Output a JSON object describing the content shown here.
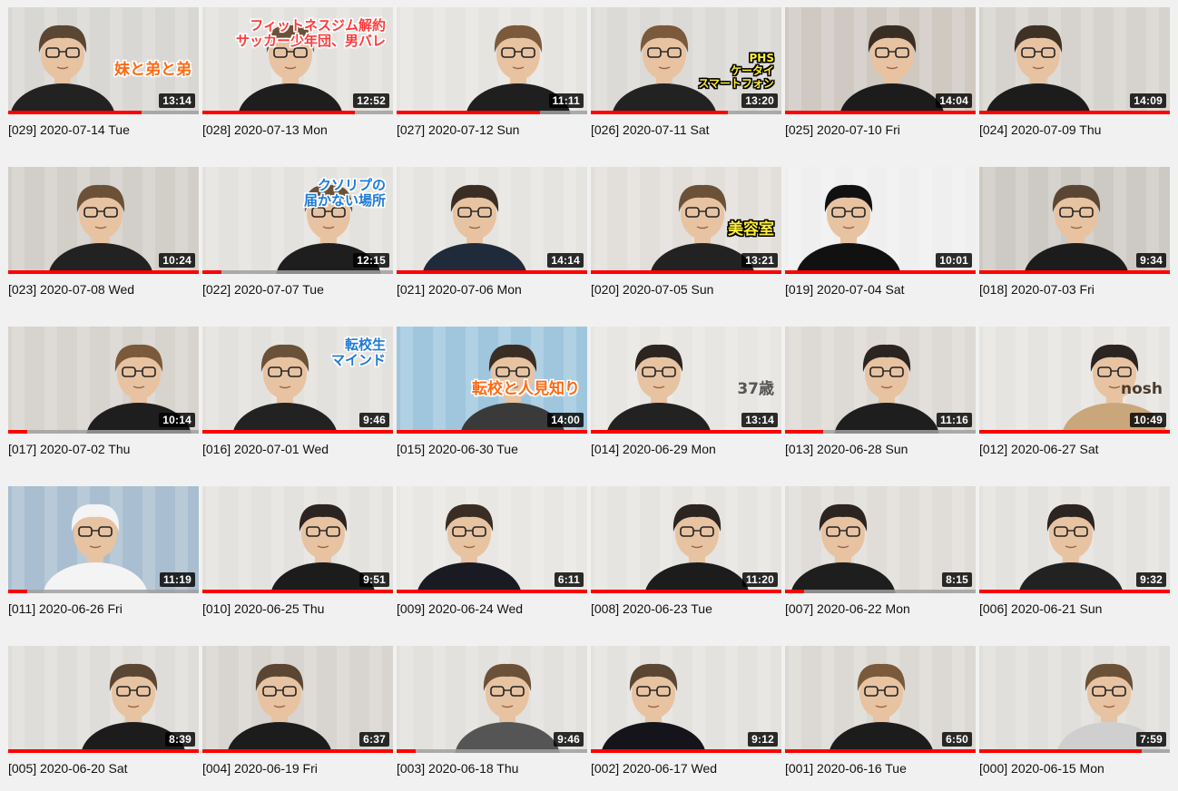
{
  "watched_color": "#ff0000",
  "videos": [
    {
      "title": "[029] 2020-07-14 Tue",
      "duration": "13:14",
      "progress": 0.7,
      "bg": "#d9d7d4",
      "shirt": "#222222",
      "hair": "#5a4632",
      "overlay": "妹と弟と弟",
      "overlay_color": "#ff6a13",
      "overlay_stroke": "#ffffff"
    },
    {
      "title": "[028] 2020-07-13 Mon",
      "duration": "12:52",
      "progress": 0.8,
      "bg": "#e3e1dd",
      "shirt": "#1e1e1e",
      "hair": "#6b5138",
      "overlay": "フィットネスジム解約\nサッカー少年団、男バレ",
      "overlay_color": "#ff3b3b",
      "overlay_stroke": "#ffffff"
    },
    {
      "title": "[027] 2020-07-12 Sun",
      "duration": "11:11",
      "progress": 0.75,
      "bg": "#e6e4e0",
      "shirt": "#1f1f1f",
      "hair": "#7a5a3a",
      "overlay": "",
      "overlay_color": "#ffffff",
      "overlay_stroke": "#000000"
    },
    {
      "title": "[026] 2020-07-11 Sat",
      "duration": "13:20",
      "progress": 0.72,
      "bg": "#dcdad6",
      "shirt": "#222222",
      "hair": "#7a5a3a",
      "overlay": "PHS\nケータイ\nスマートフォン",
      "overlay_color": "#ffee33",
      "overlay_stroke": "#000000"
    },
    {
      "title": "[025] 2020-07-10 Fri",
      "duration": "14:04",
      "progress": 1.0,
      "bg": "#cfc9c2",
      "shirt": "#1c1c1c",
      "hair": "#3a2e24",
      "overlay": "",
      "overlay_color": "#ffffff",
      "overlay_stroke": "#000000"
    },
    {
      "title": "[024] 2020-07-09 Thu",
      "duration": "14:09",
      "progress": 1.0,
      "bg": "#d6d3ce",
      "shirt": "#1c1c1c",
      "hair": "#3f3124",
      "overlay": "",
      "overlay_color": "#ffffff",
      "overlay_stroke": "#000000"
    },
    {
      "title": "[023] 2020-07-08 Wed",
      "duration": "10:24",
      "progress": 1.0,
      "bg": "#d2cfc9",
      "shirt": "#222222",
      "hair": "#6b5138",
      "overlay": "",
      "overlay_color": "#ffffff",
      "overlay_stroke": "#000000"
    },
    {
      "title": "[022] 2020-07-07 Tue",
      "duration": "12:15",
      "progress": 0.1,
      "bg": "#e4e2de",
      "shirt": "#1e1e1e",
      "hair": "#6b5138",
      "overlay": "クソリプの\n届かない場所",
      "overlay_color": "#1f7ad6",
      "overlay_stroke": "#ffffff"
    },
    {
      "title": "[021] 2020-07-06 Mon",
      "duration": "14:14",
      "progress": 1.0,
      "bg": "#e6e4e0",
      "shirt": "#1f2a3a",
      "hair": "#3a2e24",
      "overlay": "",
      "overlay_color": "#ffffff",
      "overlay_stroke": "#000000"
    },
    {
      "title": "[020] 2020-07-05 Sun",
      "duration": "13:21",
      "progress": 1.0,
      "bg": "#e2dfdb",
      "shirt": "#222222",
      "hair": "#6b5138",
      "overlay": "美容室",
      "overlay_color": "#ffee33",
      "overlay_stroke": "#000000"
    },
    {
      "title": "[019] 2020-07-04 Sat",
      "duration": "10:01",
      "progress": 1.0,
      "bg": "#efefef",
      "shirt": "#111111",
      "hair": "#111111",
      "overlay": "",
      "overlay_color": "#ffffff",
      "overlay_stroke": "#000000"
    },
    {
      "title": "[018] 2020-07-03 Fri",
      "duration": "9:34",
      "progress": 1.0,
      "bg": "#cdc9c3",
      "shirt": "#1c1c1c",
      "hair": "#5a4632",
      "overlay": "",
      "overlay_color": "#ffffff",
      "overlay_stroke": "#000000"
    },
    {
      "title": "[017] 2020-07-02 Thu",
      "duration": "10:14",
      "progress": 0.1,
      "bg": "#d7d3cd",
      "shirt": "#1e1e1e",
      "hair": "#7a5a3a",
      "overlay": "",
      "overlay_color": "#ffffff",
      "overlay_stroke": "#000000"
    },
    {
      "title": "[016] 2020-07-01 Wed",
      "duration": "9:46",
      "progress": 1.0,
      "bg": "#e3e1dd",
      "shirt": "#222222",
      "hair": "#6b5138",
      "overlay": "転校生\nマインド",
      "overlay_color": "#1f7ad6",
      "overlay_stroke": "#ffffff"
    },
    {
      "title": "[015] 2020-06-30 Tue",
      "duration": "14:00",
      "progress": 1.0,
      "bg": "#9fc6dd",
      "shirt": "#3a3a3a",
      "hair": "#3a2e24",
      "overlay": "転校と人見知り",
      "overlay_color": "#ff6a13",
      "overlay_stroke": "#ffffff"
    },
    {
      "title": "[014] 2020-06-29 Mon",
      "duration": "13:14",
      "progress": 1.0,
      "bg": "#e8e6e2",
      "shirt": "#222222",
      "hair": "#2b2420",
      "overlay": "37歳",
      "overlay_color": "#555555",
      "overlay_stroke": "none"
    },
    {
      "title": "[013] 2020-06-28 Sun",
      "duration": "11:16",
      "progress": 0.2,
      "bg": "#dddad5",
      "shirt": "#1e1e1e",
      "hair": "#2b2420",
      "overlay": "",
      "overlay_color": "#ffffff",
      "overlay_stroke": "#000000"
    },
    {
      "title": "[012] 2020-06-27 Sat",
      "duration": "10:49",
      "progress": 1.0,
      "bg": "#e6e4e0",
      "shirt": "#c9a77a",
      "hair": "#2b2420",
      "overlay": "nosh",
      "overlay_color": "#4b3a2a",
      "overlay_stroke": "none"
    },
    {
      "title": "[011] 2020-06-26 Fri",
      "duration": "11:19",
      "progress": 0.1,
      "bg": "#a9bed0",
      "shirt": "#f4f4f4",
      "hair": "#f4f4f4",
      "overlay": "",
      "overlay_color": "#ffffff",
      "overlay_stroke": "#000000"
    },
    {
      "title": "[010] 2020-06-25 Thu",
      "duration": "9:51",
      "progress": 1.0,
      "bg": "#e4e2de",
      "shirt": "#1c1c1c",
      "hair": "#2b2420",
      "overlay": "",
      "overlay_color": "#ffffff",
      "overlay_stroke": "#000000"
    },
    {
      "title": "[009] 2020-06-24 Wed",
      "duration": "6:11",
      "progress": 1.0,
      "bg": "#e9e7e3",
      "shirt": "#1a1a22",
      "hair": "#3a2e24",
      "overlay": "",
      "overlay_color": "#ffffff",
      "overlay_stroke": "#000000"
    },
    {
      "title": "[008] 2020-06-23 Tue",
      "duration": "11:20",
      "progress": 1.0,
      "bg": "#e6e4e0",
      "shirt": "#1c1c1c",
      "hair": "#2b2420",
      "overlay": "",
      "overlay_color": "#ffffff",
      "overlay_stroke": "#000000"
    },
    {
      "title": "[007] 2020-06-22 Mon",
      "duration": "8:15",
      "progress": 0.1,
      "bg": "#e0ddd8",
      "shirt": "#1e1e1e",
      "hair": "#2b2420",
      "overlay": "",
      "overlay_color": "#ffffff",
      "overlay_stroke": "#000000"
    },
    {
      "title": "[006] 2020-06-21 Sun",
      "duration": "9:32",
      "progress": 1.0,
      "bg": "#e4e2de",
      "shirt": "#222222",
      "hair": "#2b2420",
      "overlay": "",
      "overlay_color": "#ffffff",
      "overlay_stroke": "#000000"
    },
    {
      "title": "[005] 2020-06-20 Sat",
      "duration": "8:39",
      "progress": 1.0,
      "bg": "#dfddd9",
      "shirt": "#1c1c1c",
      "hair": "#5a4632",
      "overlay": "",
      "overlay_color": "#ffffff",
      "overlay_stroke": "#000000"
    },
    {
      "title": "[004] 2020-06-19 Fri",
      "duration": "6:37",
      "progress": 1.0,
      "bg": "#d8d5d0",
      "shirt": "#1c1c1c",
      "hair": "#5a4632",
      "overlay": "",
      "overlay_color": "#ffffff",
      "overlay_stroke": "#000000"
    },
    {
      "title": "[003] 2020-06-18 Thu",
      "duration": "9:46",
      "progress": 0.1,
      "bg": "#e3e1dd",
      "shirt": "#555555",
      "hair": "#6b5138",
      "overlay": "",
      "overlay_color": "#ffffff",
      "overlay_stroke": "#000000"
    },
    {
      "title": "[002] 2020-06-17 Wed",
      "duration": "9:12",
      "progress": 1.0,
      "bg": "#e4e2de",
      "shirt": "#14141a",
      "hair": "#5a4632",
      "overlay": "",
      "overlay_color": "#ffffff",
      "overlay_stroke": "#000000"
    },
    {
      "title": "[001] 2020-06-16 Tue",
      "duration": "6:50",
      "progress": 1.0,
      "bg": "#dcd9d4",
      "shirt": "#1c1c1c",
      "hair": "#7a5a3a",
      "overlay": "",
      "overlay_color": "#ffffff",
      "overlay_stroke": "#000000"
    },
    {
      "title": "[000] 2020-06-15 Mon",
      "duration": "7:59",
      "progress": 0.85,
      "bg": "#e1dfdb",
      "shirt": "#cfcfcf",
      "hair": "#6b5138",
      "overlay": "",
      "overlay_color": "#ffffff",
      "overlay_stroke": "#000000"
    }
  ]
}
